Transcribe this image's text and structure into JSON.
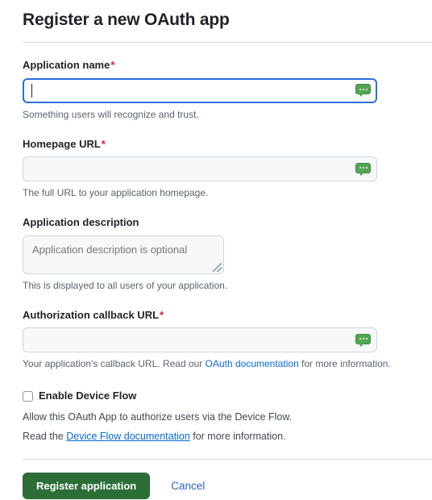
{
  "page": {
    "title": "Register a new OAuth app"
  },
  "fields": {
    "application_name": {
      "label": "Application name",
      "required_marker": "*",
      "value": "",
      "placeholder": "",
      "help": "Something users will recognize and trust."
    },
    "homepage_url": {
      "label": "Homepage URL",
      "required_marker": "*",
      "value": "",
      "placeholder": "",
      "help": "The full URL to your application homepage."
    },
    "application_description": {
      "label": "Application description",
      "required_marker": "",
      "value": "",
      "placeholder": "Application description is optional",
      "help": "This is displayed to all users of your application."
    },
    "authorization_callback_url": {
      "label": "Authorization callback URL",
      "required_marker": "*",
      "value": "",
      "placeholder": "",
      "help_before": "Your application's callback URL. Read our ",
      "help_link": "OAuth documentation",
      "help_after": " for more information."
    }
  },
  "device_flow": {
    "checkbox_label": "Enable Device Flow",
    "checked": false,
    "help_line1": "Allow this OAuth App to authorize users via the Device Flow.",
    "help_line2_before": "Read the ",
    "help_line2_link": "Device Flow documentation",
    "help_line2_after": " for more information."
  },
  "actions": {
    "submit_label": "Register application",
    "cancel_label": "Cancel"
  },
  "icons": {
    "extension_badge": "speech-bubble-icon"
  },
  "colors": {
    "primary_button": "#2c6e38",
    "link": "#0969da",
    "cancel_link": "#2964d6",
    "required_star": "#cf222e",
    "focus_border": "#2f6fdb",
    "input_bg": "#f6f8fa",
    "border": "#d0d7de",
    "divider": "#d8dee4",
    "help_text": "#59636e",
    "badge_green": "#53a653"
  }
}
